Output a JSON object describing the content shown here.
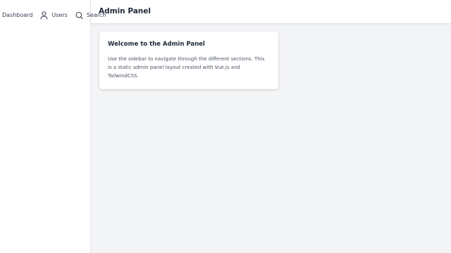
{
  "sidebar": {
    "items": [
      {
        "label": "Dashboard",
        "icon": ""
      },
      {
        "label": "Users",
        "icon": "user-icon"
      },
      {
        "label": "Search",
        "icon": "search-icon"
      }
    ]
  },
  "header": {
    "title": "Admin Panel"
  },
  "main": {
    "card": {
      "title": "Welcome to the Admin Panel",
      "body": "Use the sidebar to navigate through the different sections. This is a static admin panel layout created with Vue.js and TailwindCSS."
    }
  },
  "colors": {
    "main_background": "#f3f4f6",
    "card_background": "#ffffff",
    "text_primary": "#1f2937",
    "text_secondary": "#4b5563"
  }
}
